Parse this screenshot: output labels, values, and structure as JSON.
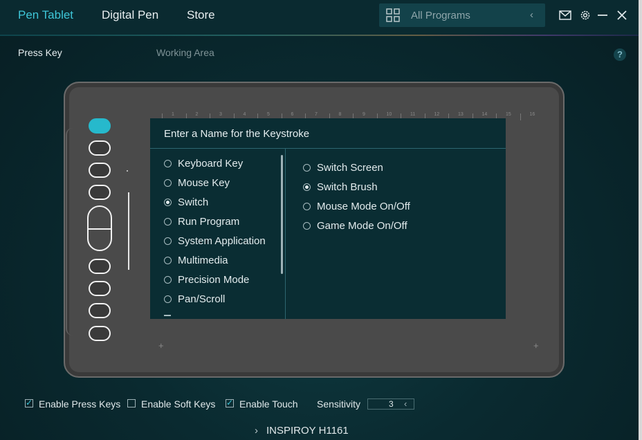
{
  "header": {
    "tabs": [
      {
        "label": "Pen Tablet",
        "active": true
      },
      {
        "label": "Digital Pen",
        "active": false
      },
      {
        "label": "Store",
        "active": false
      }
    ],
    "search_placeholder": "All Programs",
    "icons": [
      "grid-icon",
      "chevron-left-icon",
      "mail-icon",
      "gear-icon",
      "minimize-icon",
      "close-icon"
    ]
  },
  "subtabs": [
    {
      "label": "Press Key",
      "active": true
    },
    {
      "label": "Working Area",
      "active": false
    }
  ],
  "help": "?",
  "ruler": [
    "1",
    "2",
    "3",
    "4",
    "5",
    "6",
    "7",
    "8",
    "9",
    "10",
    "11",
    "12",
    "13",
    "14",
    "15",
    "16"
  ],
  "dialog": {
    "title": "Enter a Name for the Keystroke",
    "categories": [
      {
        "label": "Keyboard Key",
        "selected": false
      },
      {
        "label": "Mouse Key",
        "selected": false
      },
      {
        "label": "Switch",
        "selected": true
      },
      {
        "label": "Run Program",
        "selected": false
      },
      {
        "label": "System Application",
        "selected": false
      },
      {
        "label": "Multimedia",
        "selected": false
      },
      {
        "label": "Precision Mode",
        "selected": false
      },
      {
        "label": "Pan/Scroll",
        "selected": false
      }
    ],
    "options": [
      {
        "label": "Switch Screen",
        "selected": false
      },
      {
        "label": "Switch Brush",
        "selected": true
      },
      {
        "label": "Mouse Mode On/Off",
        "selected": false
      },
      {
        "label": "Game Mode On/Off",
        "selected": false
      }
    ]
  },
  "footer": {
    "enable_press_keys": {
      "label": "Enable Press Keys",
      "checked": true
    },
    "enable_soft_keys": {
      "label": "Enable Soft Keys",
      "checked": false
    },
    "enable_touch": {
      "label": "Enable Touch",
      "checked": true
    },
    "sensitivity_label": "Sensitivity",
    "sensitivity_value": "3",
    "device_name": "INSPIROY H1161"
  },
  "colors": {
    "accent": "#3ec6d8",
    "active_key": "#26b9cc",
    "dialog_bg": "#0a2d33"
  }
}
